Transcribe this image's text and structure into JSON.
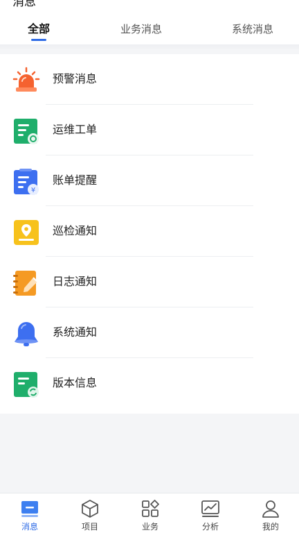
{
  "header": {
    "title": "消息",
    "tabs": [
      {
        "label": "全部",
        "active": true
      },
      {
        "label": "业务消息",
        "active": false
      },
      {
        "label": "系统消息",
        "active": false
      }
    ]
  },
  "list": {
    "items": [
      {
        "label": "预警消息",
        "icon": "alarm-siren-icon"
      },
      {
        "label": "运维工单",
        "icon": "work-order-icon"
      },
      {
        "label": "账单提醒",
        "icon": "bill-icon"
      },
      {
        "label": "巡检通知",
        "icon": "inspection-location-icon"
      },
      {
        "label": "日志通知",
        "icon": "log-notebook-icon"
      },
      {
        "label": "系统通知",
        "icon": "bell-icon"
      },
      {
        "label": "版本信息",
        "icon": "version-update-icon"
      }
    ]
  },
  "bottom_nav": {
    "items": [
      {
        "label": "消息",
        "icon": "message-icon",
        "active": true
      },
      {
        "label": "项目",
        "icon": "cube-icon",
        "active": false
      },
      {
        "label": "业务",
        "icon": "grid-apps-icon",
        "active": false
      },
      {
        "label": "分析",
        "icon": "chart-icon",
        "active": false
      },
      {
        "label": "我的",
        "icon": "user-icon",
        "active": false
      }
    ]
  },
  "colors": {
    "accent": "#2e6be6",
    "alarm": "#f5622f",
    "green": "#1fae6b",
    "blue": "#3d6ff0",
    "yellow": "#f7c21c",
    "orange": "#f59a23"
  }
}
